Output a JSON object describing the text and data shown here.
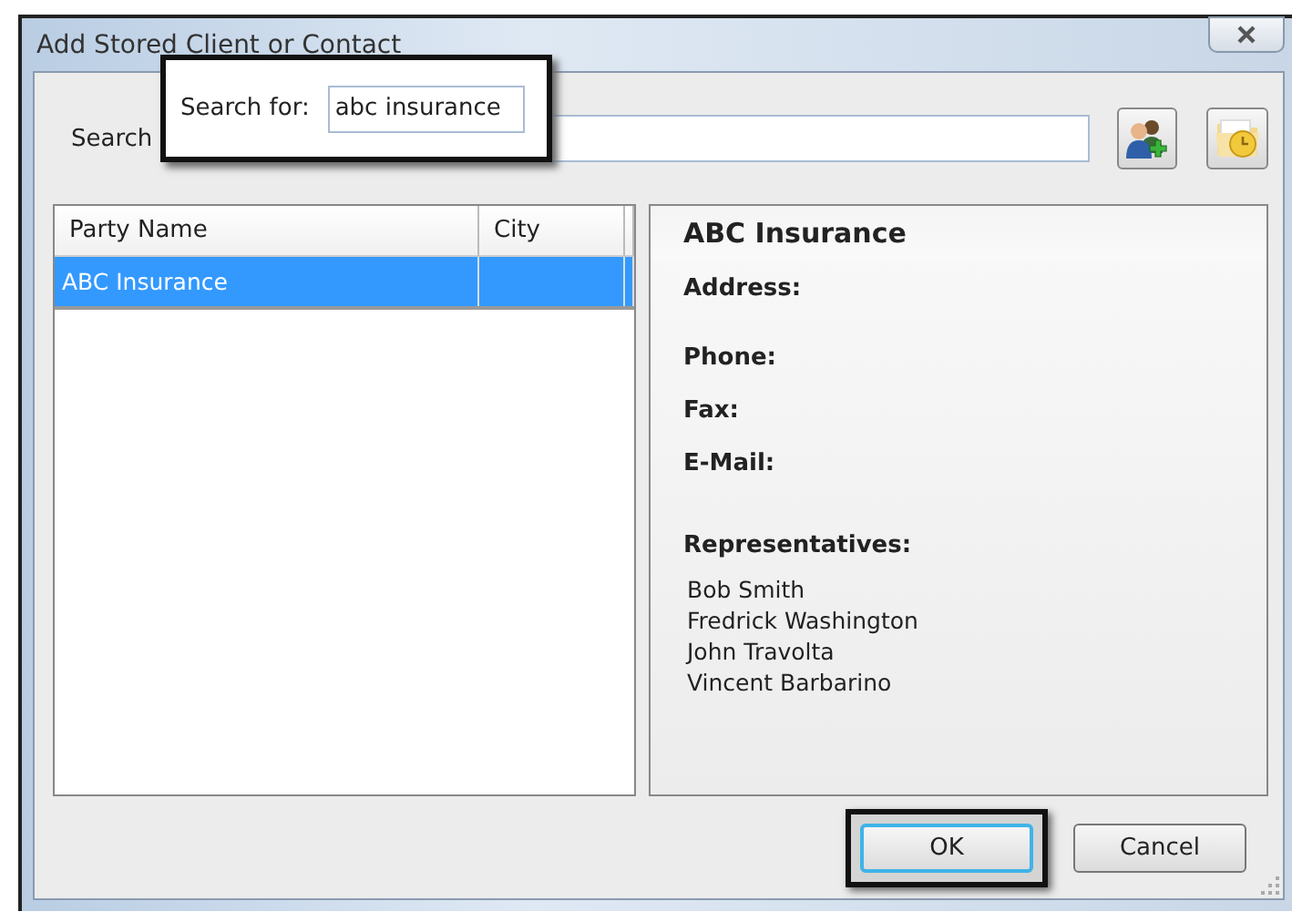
{
  "window": {
    "title": "Add Stored Client or Contact"
  },
  "search": {
    "label": "Search"
  },
  "callout": {
    "label": "Search for:",
    "value": "abc insurance"
  },
  "table": {
    "columns": [
      "Party Name",
      "City"
    ],
    "rows": [
      {
        "cells": [
          "ABC Insurance",
          ""
        ],
        "selected": true
      }
    ]
  },
  "details": {
    "name": "ABC Insurance",
    "fields": [
      "Address:",
      "Phone:",
      "Fax:",
      "E-Mail:"
    ],
    "representatives_label": "Representatives:",
    "representatives": [
      "Bob Smith",
      "Fredrick Washington",
      "John Travolta",
      "Vincent Barbarino"
    ]
  },
  "buttons": [
    {
      "label": "OK",
      "default": true,
      "highlighted": true
    },
    {
      "label": "Cancel",
      "default": false,
      "highlighted": false
    }
  ]
}
